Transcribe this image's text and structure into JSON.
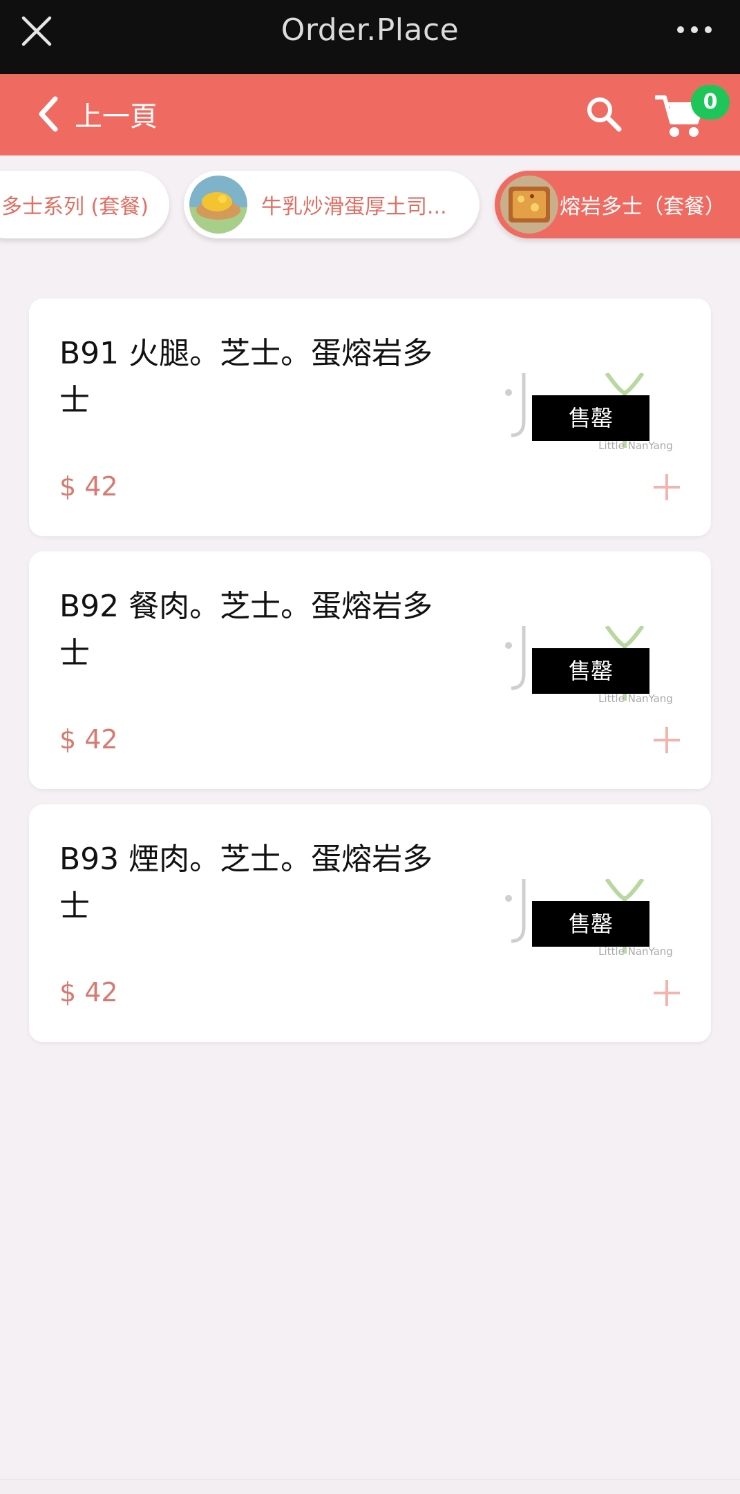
{
  "topbar": {
    "title": "Order.Place"
  },
  "navbar": {
    "back_label": "上一頁",
    "cart_count": "0"
  },
  "categories": [
    {
      "label": "多士系列 (套餐)"
    },
    {
      "label": "牛乳炒滑蛋厚土司..."
    },
    {
      "label": "熔岩多士（套餐）"
    }
  ],
  "products": [
    {
      "name": "B91 火腿。芝士。蛋熔岩多士",
      "price": "$ 42",
      "status": "售罄"
    },
    {
      "name": "B92 餐肉。芝士。蛋熔岩多士",
      "price": "$ 42",
      "status": "售罄"
    },
    {
      "name": "B93 煙肉。芝士。蛋熔岩多士",
      "price": "$ 42",
      "status": "售罄"
    }
  ],
  "brand_logo_text": "Little NanYang",
  "colors": {
    "accent": "#ef6b61",
    "badge": "#1ec65a",
    "price": "#d87a70",
    "background": "#f5f0f3"
  },
  "icons": [
    "close-icon",
    "more-icon",
    "chevron-left-icon",
    "search-icon",
    "cart-icon",
    "plus-icon"
  ]
}
